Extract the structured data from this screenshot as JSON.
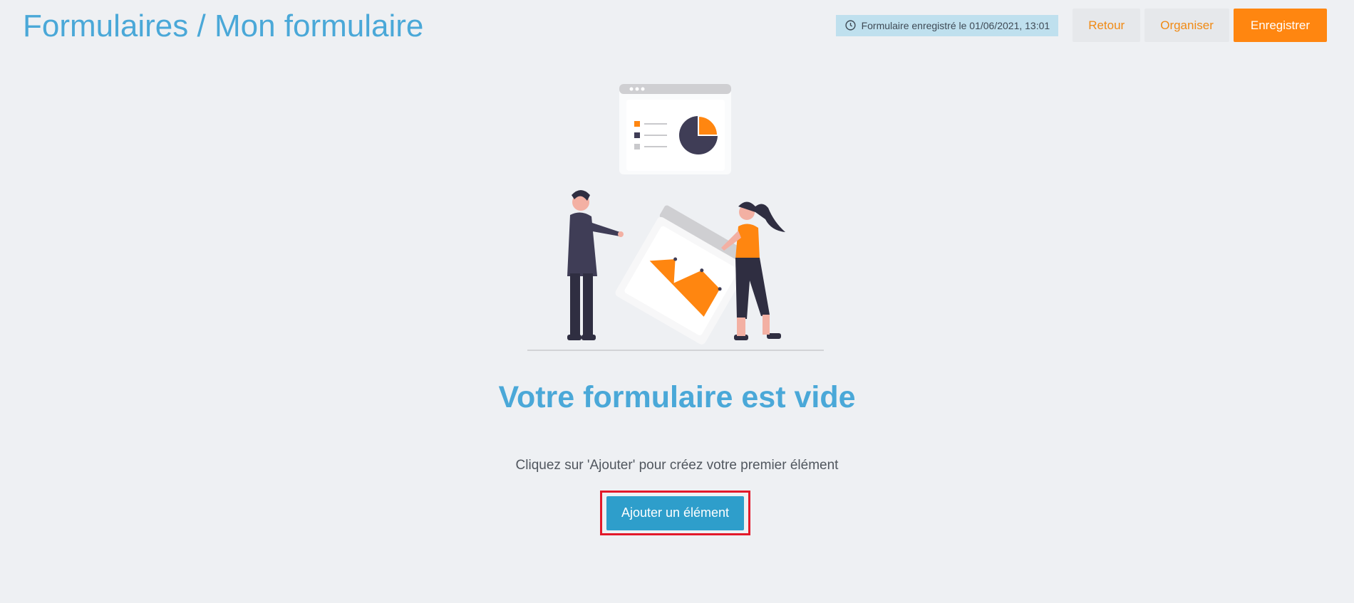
{
  "header": {
    "title": "Formulaires / Mon formulaire",
    "saved_status": "Formulaire enregistré le 01/06/2021, 13:01",
    "back_label": "Retour",
    "organize_label": "Organiser",
    "save_label": "Enregistrer"
  },
  "empty_state": {
    "title": "Votre formulaire est vide",
    "subtitle": "Cliquez sur 'Ajouter' pour créez votre premier élément",
    "add_button_label": "Ajouter un élément"
  },
  "colors": {
    "accent_blue": "#4aa8d8",
    "accent_orange": "#ff8610",
    "button_blue": "#2e9ecb",
    "highlight_red": "#e3192a"
  },
  "icons": {
    "saved_status": "clock-icon",
    "illustration": "team-presenting-charts-illustration"
  }
}
